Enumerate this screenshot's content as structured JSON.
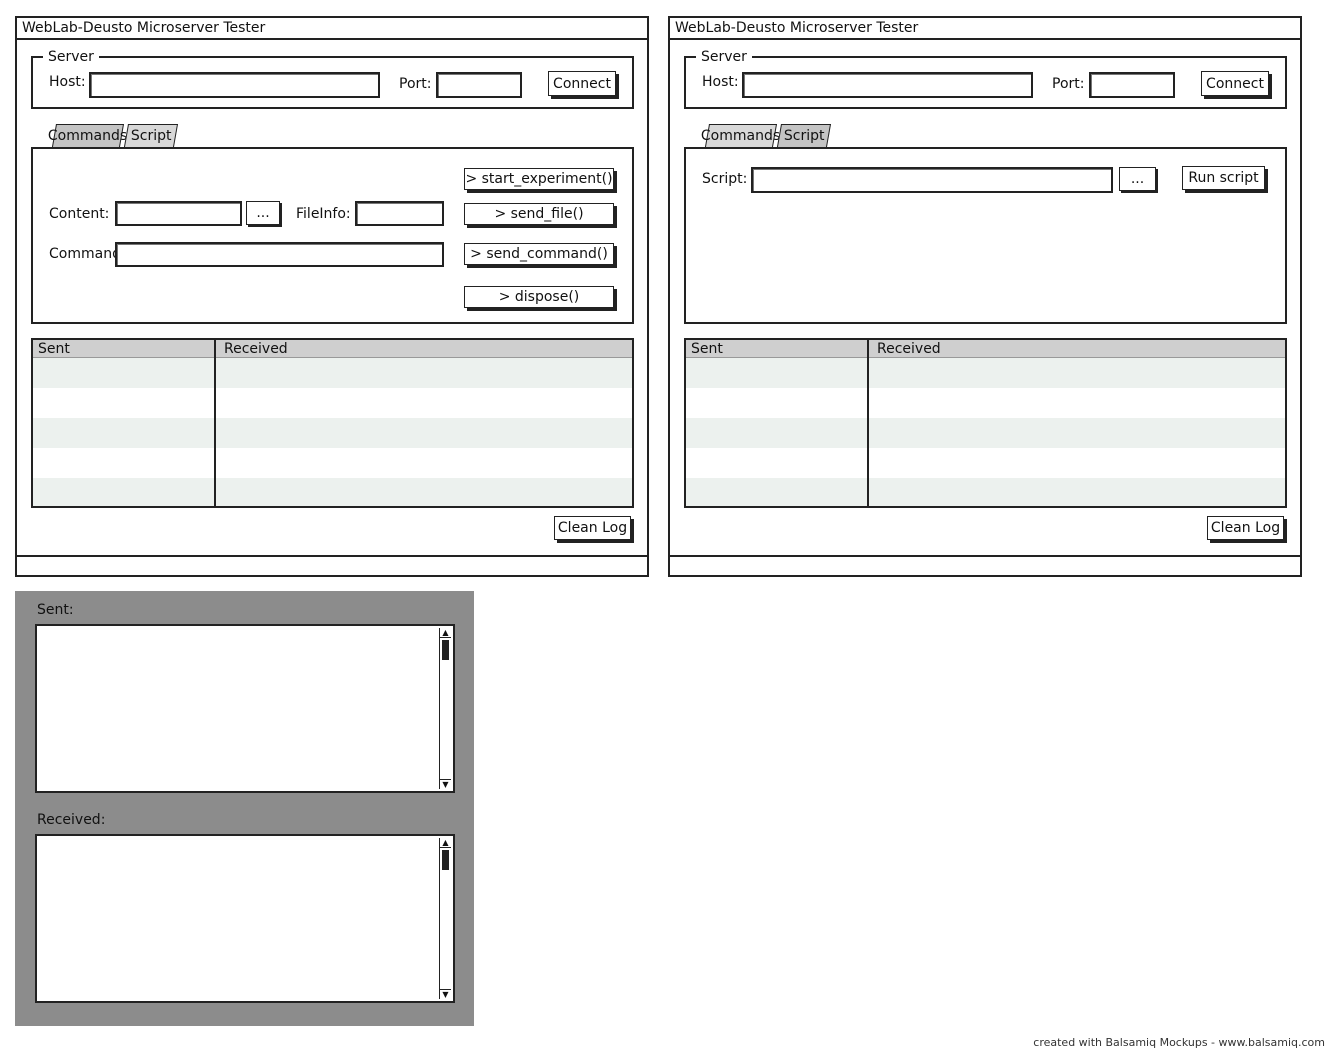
{
  "left_window": {
    "title": "WebLab-Deusto Microserver Tester",
    "server": {
      "legend": "Server",
      "host_label": "Host:",
      "host_value": "",
      "port_label": "Port:",
      "port_value": "",
      "connect_label": "Connect"
    },
    "tabs": [
      {
        "label": "Commands",
        "active": true
      },
      {
        "label": "Script",
        "active": false
      }
    ],
    "commands": {
      "content_label": "Content:",
      "content_value": "",
      "browse_label": "...",
      "fileinfo_label": "FileInfo:",
      "fileinfo_value": "",
      "command_label": "Command:",
      "command_value": "",
      "start_experiment_label": "> start_experiment()",
      "send_file_label": "> send_file()",
      "send_command_label": "> send_command()",
      "dispose_label": "> dispose()"
    },
    "log": {
      "columns": [
        "Sent",
        "Received"
      ],
      "rows": [
        [
          "",
          ""
        ],
        [
          "",
          ""
        ],
        [
          "",
          ""
        ],
        [
          "",
          ""
        ],
        [
          "",
          ""
        ]
      ]
    },
    "clean_log_label": "Clean Log"
  },
  "right_window": {
    "title": "WebLab-Deusto Microserver Tester",
    "server": {
      "legend": "Server",
      "host_label": "Host:",
      "host_value": "",
      "port_label": "Port:",
      "port_value": "",
      "connect_label": "Connect"
    },
    "tabs": [
      {
        "label": "Commands",
        "active": false
      },
      {
        "label": "Script",
        "active": true
      }
    ],
    "script": {
      "script_label": "Script:",
      "script_value": "",
      "browse_label": "...",
      "run_label": "Run script"
    },
    "log": {
      "columns": [
        "Sent",
        "Received"
      ],
      "rows": [
        [
          "",
          ""
        ],
        [
          "",
          ""
        ],
        [
          "",
          ""
        ],
        [
          "",
          ""
        ],
        [
          "",
          ""
        ]
      ]
    },
    "clean_log_label": "Clean Log"
  },
  "detail_panel": {
    "sent_label": "Sent:",
    "sent_value": "",
    "received_label": "Received:",
    "received_value": ""
  },
  "footer": "created with Balsamiq Mockups - www.balsamiq.com",
  "colors": {
    "stroke": "#222222",
    "tab_bg": "#d8d8d8",
    "grid_header": "#cfcfcf",
    "grid_alt_row": "#ecf1ee",
    "panel_gray": "#8c8c8c"
  }
}
